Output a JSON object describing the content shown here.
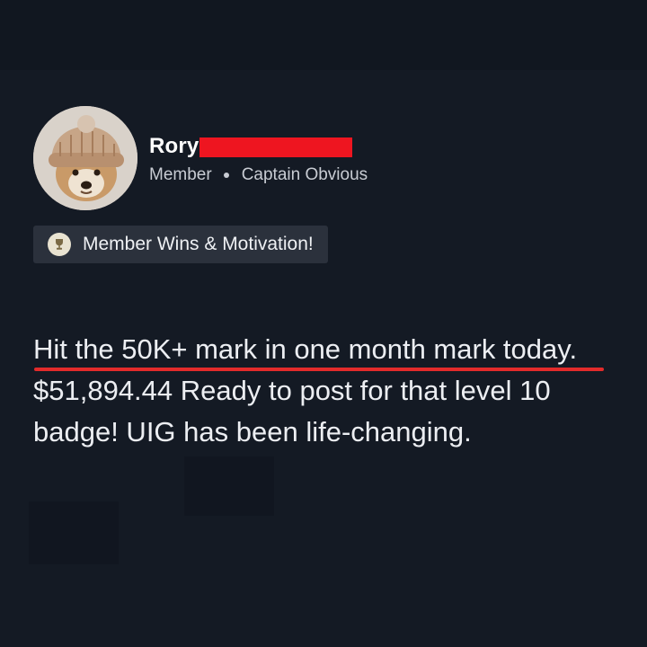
{
  "post": {
    "author": {
      "name": "Rory",
      "role": "Member",
      "title": "Captain Obvious",
      "avatar_icon": "doge-with-knit-hat-avatar"
    },
    "category": {
      "icon": "trophy-icon",
      "label": "Member Wins & Motivation!"
    },
    "body": "Hit the 50K+ mark in one month mark today. $51,894.44 Ready to post for that level 10 badge! UIG has been life-changing."
  },
  "colors": {
    "background": "#141a24",
    "redaction": "#ee1520",
    "underline": "#e32b2b",
    "chip_background": "#2b313c"
  }
}
